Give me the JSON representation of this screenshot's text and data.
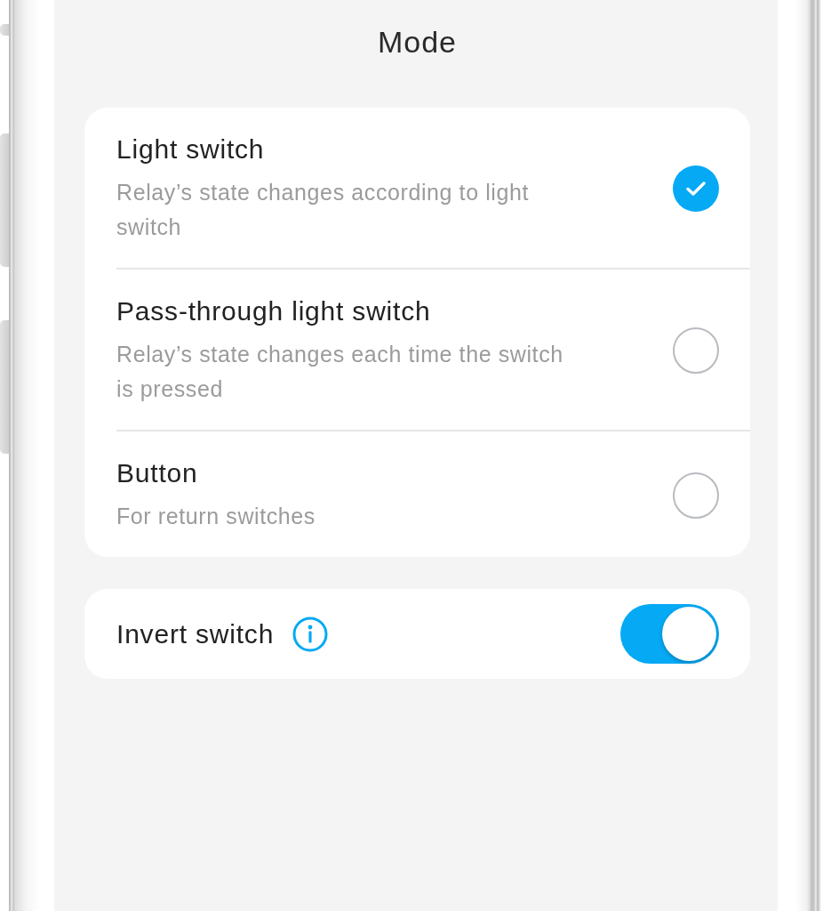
{
  "screen": {
    "title": "Mode"
  },
  "modes": [
    {
      "title": "Light switch",
      "description": "Relay’s state changes according to light switch",
      "selected": true
    },
    {
      "title": "Pass-through light switch",
      "description": "Relay’s state changes each time the switch is pressed",
      "selected": false
    },
    {
      "title": "Button",
      "description": "For return switches",
      "selected": false
    }
  ],
  "invert_switch": {
    "label": "Invert switch",
    "on": true
  }
}
